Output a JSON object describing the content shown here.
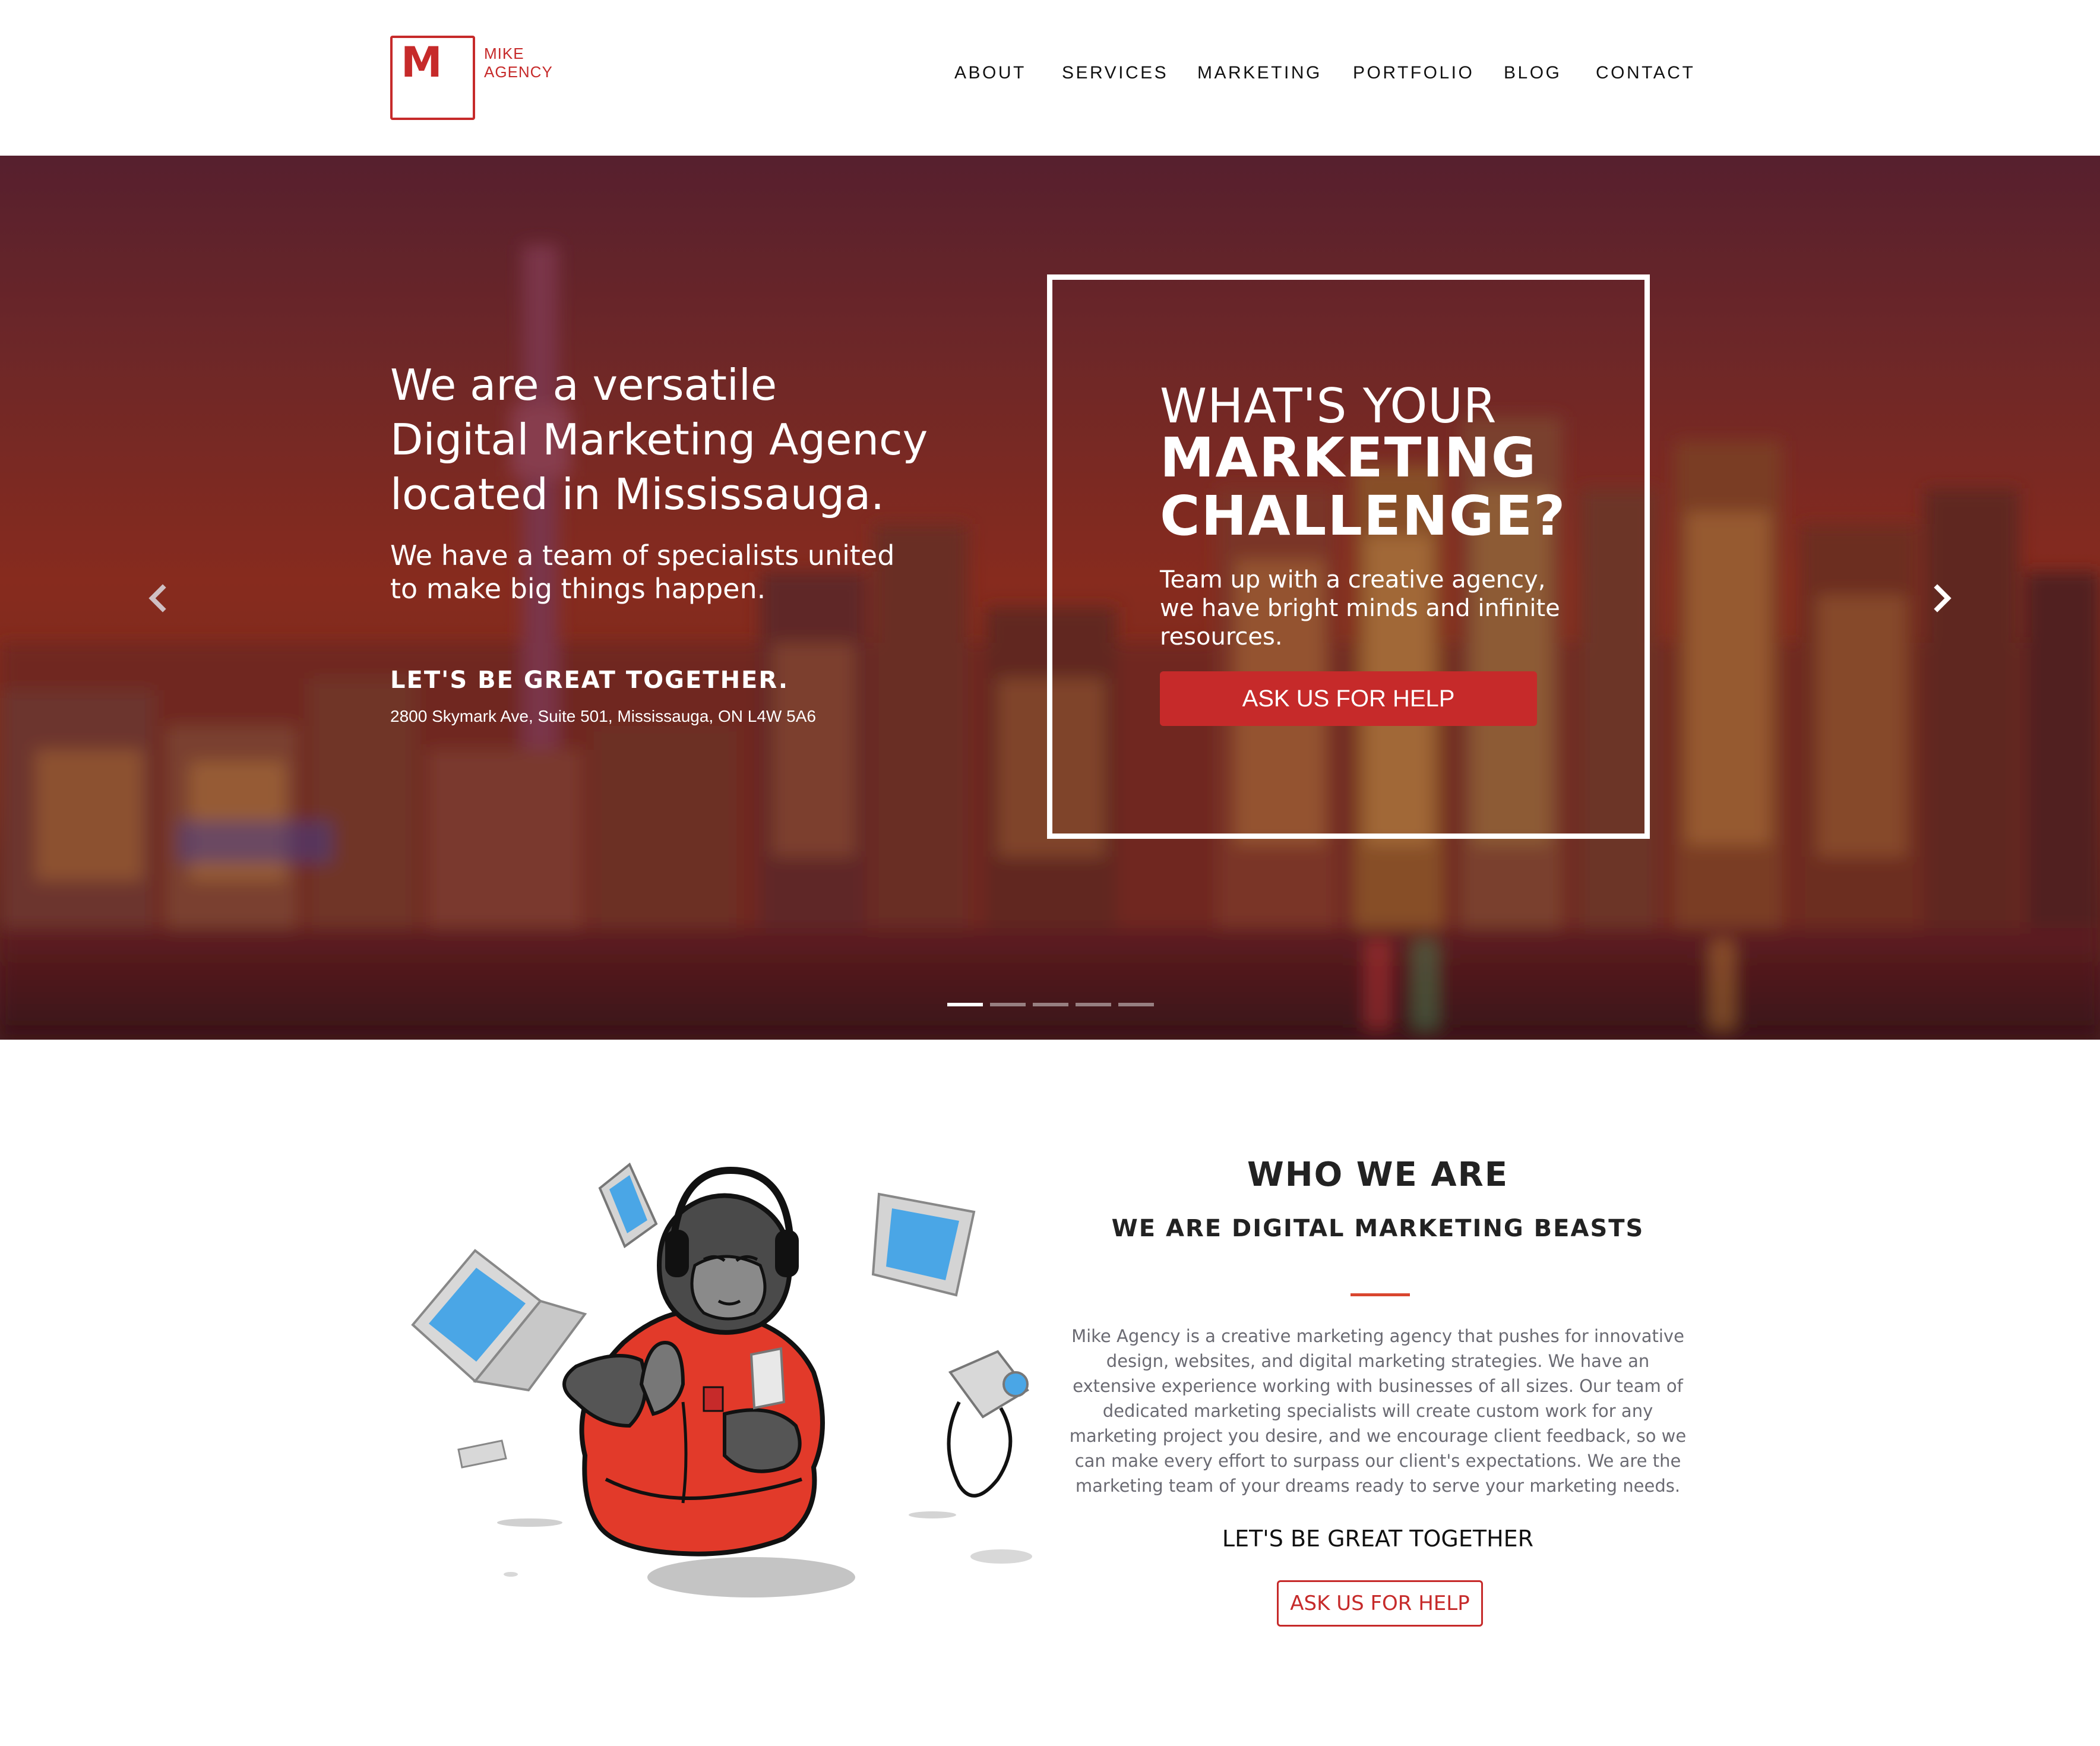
{
  "brand": {
    "logo_letter": "M",
    "name_line1": "MIKE",
    "name_line2": "AGENCY",
    "accent_color": "#c62a2a"
  },
  "nav": {
    "items": [
      {
        "label": "ABOUT"
      },
      {
        "label": "SERVICES"
      },
      {
        "label": "MARKETING"
      },
      {
        "label": "PORTFOLIO"
      },
      {
        "label": "BLOG"
      },
      {
        "label": "CONTACT"
      }
    ]
  },
  "hero": {
    "heading": "We are a versatile\nDigital Marketing Agency\nlocated in Mississauga.",
    "subheading": "We have a team of specialists united\nto make big things happen.",
    "tagline": "LET'S BE GREAT TOGETHER.",
    "address": "2800 Skymark Ave, Suite 501, Mississauga, ON L4W 5A6",
    "card": {
      "title_line1": "WHAT'S YOUR",
      "title_bold": "MARKETING\nCHALLENGE?",
      "text": "Team up with a creative agency, we have bright minds and infinite resources.",
      "button_label": "ASK US FOR HELP"
    },
    "prev_icon": "chevron-left-icon",
    "next_icon": "chevron-right-icon",
    "slide_count": 5,
    "active_slide": 1
  },
  "who": {
    "title": "WHO WE ARE",
    "subtitle": "WE ARE DIGITAL MARKETING BEASTS",
    "body": "Mike Agency is a creative marketing agency that pushes for innovative design, websites, and digital marketing strategies. We have an extensive experience working with businesses of all sizes. Our team of dedicated marketing specialists will create custom work for any marketing project you desire, and we encourage client feedback, so we can make every effort to surpass our client's expectations. We are the marketing team of your dreams ready to serve your marketing needs.",
    "cta_label": "LET'S BE GREAT TOGETHER",
    "button_label": "ASK US FOR HELP",
    "illustration": "meditating-gorilla-with-devices"
  }
}
